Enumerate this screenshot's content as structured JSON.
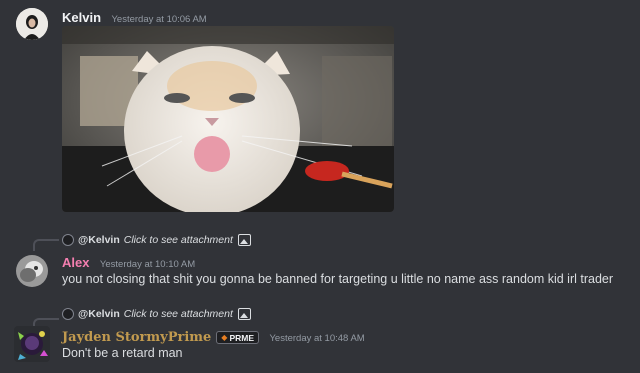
{
  "messages": [
    {
      "username": "Kelvin",
      "username_color": "#f2f3f5",
      "timestamp": "Yesterday at 10:06 AM",
      "attachment": {
        "alt": "gif-cat-tongue"
      }
    },
    {
      "reply": {
        "user": "@Kelvin",
        "text": "Click to see attachment"
      },
      "username": "Alex",
      "username_color": "#f47fb0",
      "timestamp": "Yesterday at 10:10 AM",
      "text": "you not closing that shit you gonna be banned for targeting u little no name ass random kid irl trader"
    },
    {
      "reply": {
        "user": "@Kelvin",
        "text": "Click to see attachment"
      },
      "username": "Jayden StormyPrime",
      "username_color": "#c19a4f",
      "badge": "PRME",
      "timestamp": "Yesterday at 10:48 AM",
      "text": "Don't be a retard man"
    }
  ]
}
